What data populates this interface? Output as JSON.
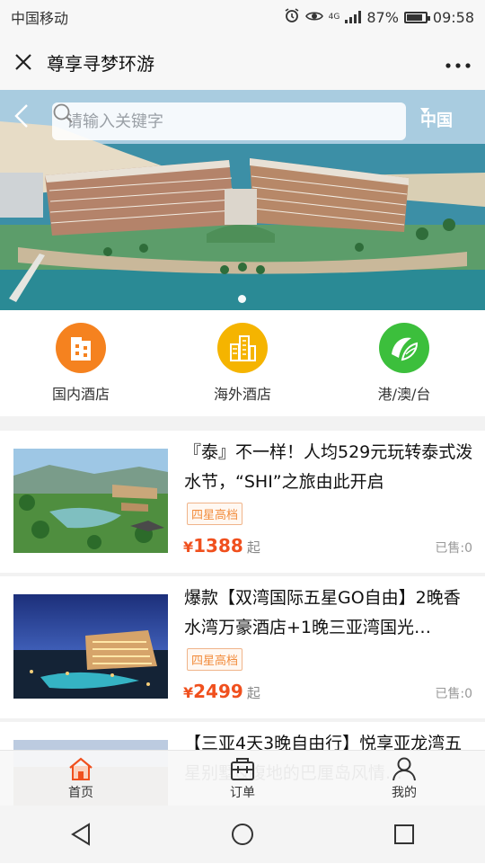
{
  "status_bar": {
    "carrier": "中国移动",
    "network": "4G",
    "battery": "87%",
    "time": "09:58"
  },
  "title_bar": {
    "title": "尊享寻梦环游"
  },
  "banner": {
    "search_placeholder": "请输入关键字",
    "region": "中国"
  },
  "quick_nav": [
    {
      "label": "国内酒店",
      "icon": "building-icon",
      "color": "#f5821f"
    },
    {
      "label": "海外酒店",
      "icon": "skyscraper-icon",
      "color": "#f5b400"
    },
    {
      "label": "港/澳/台",
      "icon": "hk-macau-taiwan-icon",
      "color": "#3cbf3c"
    }
  ],
  "products": [
    {
      "title": "『泰』不一样！人均529元玩转泰式泼水节，“SHI”之旅由此开启",
      "tag": "四星高档",
      "currency": "¥",
      "price": "1388",
      "price_suffix": "起",
      "sold": "已售:0"
    },
    {
      "title": "爆款【双湾国际五星GO自由】2晚香水湾万豪酒店+1晚三亚湾国光…",
      "tag": "四星高档",
      "currency": "¥",
      "price": "2499",
      "price_suffix": "起",
      "sold": "已售:0"
    },
    {
      "title": "【三亚4天3晚自由行】悦享亚龙湾五星别墅&腹地的巴厘岛风情…"
    }
  ],
  "tab_bar": [
    {
      "label": "首页",
      "icon": "home-icon",
      "active_color": "#f0501e"
    },
    {
      "label": "订单",
      "icon": "order-icon"
    },
    {
      "label": "我的",
      "icon": "profile-icon"
    }
  ]
}
